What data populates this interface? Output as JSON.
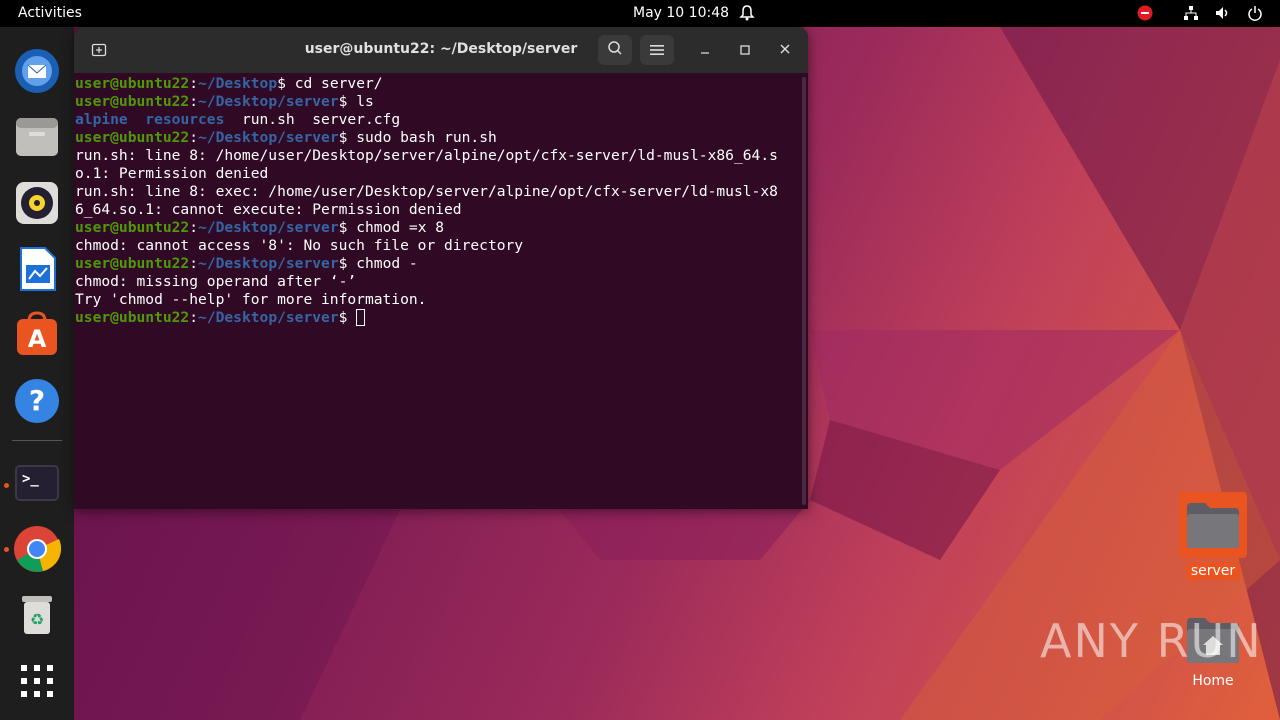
{
  "topbar": {
    "activities": "Activities",
    "clock": "May 10  10:48"
  },
  "dock": {
    "items": [
      "thunderbird",
      "files",
      "rhythmbox",
      "libreoffice-writer",
      "ubuntu-software",
      "help",
      "terminal",
      "chrome",
      "trash",
      "show-applications"
    ]
  },
  "terminal": {
    "title": "user@ubuntu22: ~/Desktop/server",
    "prompt_user": "user@ubuntu22",
    "lines": [
      {
        "type": "prompt",
        "path": "~/Desktop",
        "cmd": " cd server/"
      },
      {
        "type": "prompt",
        "path": "~/Desktop/server",
        "cmd": " ls"
      },
      {
        "type": "ls",
        "dirs": [
          "alpine",
          "resources"
        ],
        "files": "run.sh  server.cfg"
      },
      {
        "type": "prompt",
        "path": "~/Desktop/server",
        "cmd": " sudo bash run.sh"
      },
      {
        "type": "out",
        "text": "run.sh: line 8: /home/user/Desktop/server/alpine/opt/cfx-server/ld-musl-x86_64.s"
      },
      {
        "type": "out",
        "text": "o.1: Permission denied"
      },
      {
        "type": "out",
        "text": "run.sh: line 8: exec: /home/user/Desktop/server/alpine/opt/cfx-server/ld-musl-x8"
      },
      {
        "type": "out",
        "text": "6_64.so.1: cannot execute: Permission denied"
      },
      {
        "type": "prompt",
        "path": "~/Desktop/server",
        "cmd": " chmod =x 8"
      },
      {
        "type": "out",
        "text": "chmod: cannot access '8': No such file or directory"
      },
      {
        "type": "prompt",
        "path": "~/Desktop/server",
        "cmd": " chmod -"
      },
      {
        "type": "out",
        "text": "chmod: missing operand after ‘-’"
      },
      {
        "type": "out",
        "text": "Try 'chmod --help' for more information."
      },
      {
        "type": "prompt",
        "path": "~/Desktop/server",
        "cmd": " ",
        "cursor": true
      }
    ]
  },
  "desktop": {
    "icons": [
      {
        "name": "server",
        "label": "server"
      },
      {
        "name": "home",
        "label": "Home"
      }
    ],
    "watermark": "ANY RUN"
  },
  "colors": {
    "terminal_bg": "#300a24",
    "prompt_user": "#4e9a06",
    "prompt_path": "#3465a4",
    "accent": "#e95420"
  }
}
